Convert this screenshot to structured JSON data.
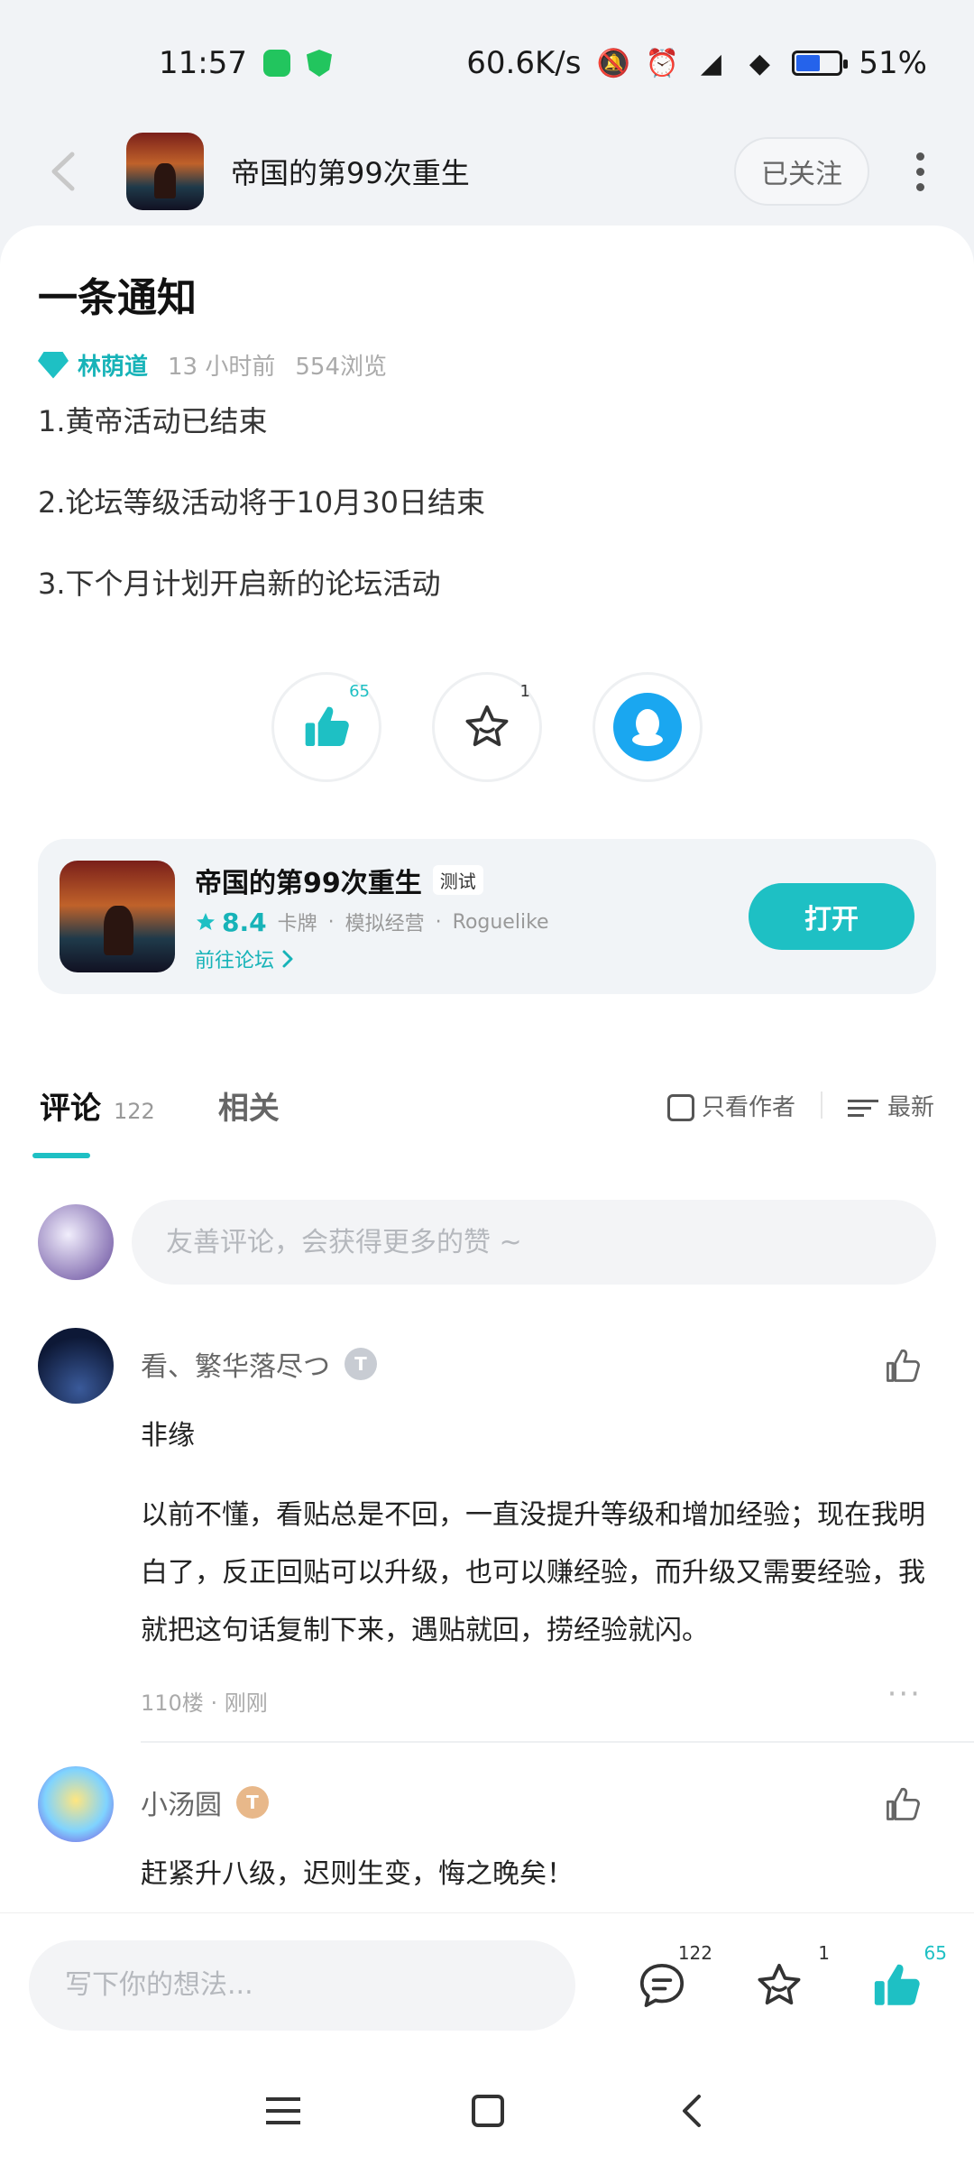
{
  "status_bar": {
    "time": "11:57",
    "network_speed": "60.6K/s",
    "battery": "51%"
  },
  "header": {
    "title": "帝国的第99次重生",
    "follow_label": "已关注"
  },
  "post": {
    "title": "一条通知",
    "author": "林荫道",
    "time": "13 小时前",
    "views": "554浏览",
    "lines": [
      "1.黄帝活动已结束",
      "2.论坛等级活动将于10月30日结束",
      "3.下个月计划开启新的论坛活动"
    ],
    "like_count": "65",
    "favorite_count": "1"
  },
  "game_card": {
    "name": "帝国的第99次重生",
    "tag": "测试",
    "rating": "8.4",
    "genres": [
      "卡牌",
      "模拟经营",
      "Roguelike"
    ],
    "forum_link": "前往论坛",
    "open_label": "打开"
  },
  "comments_section": {
    "tab_comments": "评论",
    "comment_count": "122",
    "tab_related": "相关",
    "filter_author_only": "只看作者",
    "sort_label": "最新",
    "input_placeholder": "友善评论，会获得更多的赞 ~",
    "items": [
      {
        "name": "看、繁华落尽つ",
        "level": "T",
        "text_lines": [
          "非缘",
          "以前不懂，看贴总是不回，一直没提升等级和增加经验；现在我明白了，反正回贴可以升级，也可以赚经验，而升级又需要经验，我就把这句话复制下来，遇贴就回，捞经验就闪。"
        ],
        "floor": "110楼",
        "time": "刚刚"
      },
      {
        "name": "小汤圆",
        "level": "T",
        "text_lines": [
          "赶紧升八级，迟则生变，悔之晚矣！"
        ]
      }
    ]
  },
  "bottom_bar": {
    "placeholder": "写下你的想法...",
    "comment_count": "122",
    "favorite_count": "1",
    "like_count": "65"
  },
  "colors": {
    "accent": "#1ec0c4",
    "qq_blue": "#1aa7f0"
  }
}
